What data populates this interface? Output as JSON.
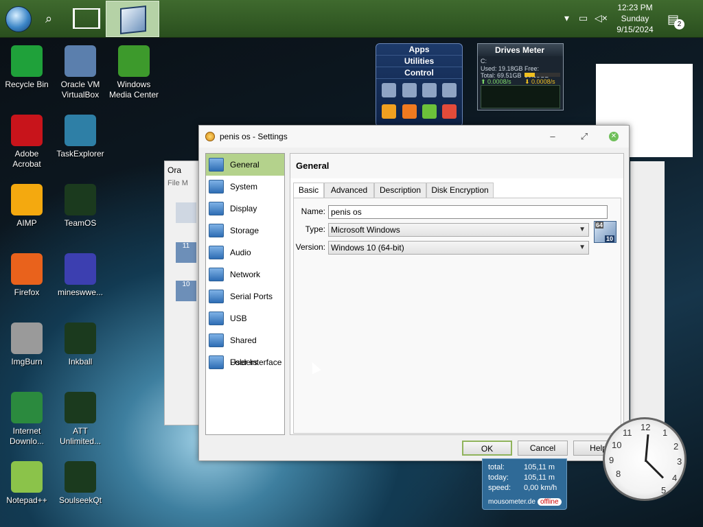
{
  "taskbar": {
    "start_icon": "windows-orb",
    "search_icon": "search-icon",
    "taskview_icon": "task-view-icon",
    "pinned_app": "virtualbox-icon",
    "tray_icons": [
      "chevron-up-icon",
      "network-icon",
      "volume-muted-icon"
    ],
    "clock": {
      "time": "12:23 PM",
      "day": "Sunday",
      "date": "9/15/2024"
    },
    "notifications_count": "2"
  },
  "desktop_icons": [
    {
      "label": "Recycle Bin",
      "icon": "recycle-bin-icon",
      "color": "#1fa13a"
    },
    {
      "label": "Oracle VM VirtualBox",
      "icon": "virtualbox-icon",
      "color": "#5b7fad"
    },
    {
      "label": "Windows Media Center",
      "icon": "media-center-icon",
      "color": "#3d9a2c"
    },
    {
      "label": "Adobe Acrobat",
      "icon": "acrobat-icon",
      "color": "#c8141b"
    },
    {
      "label": "TaskExplorer",
      "icon": "task-explorer-icon",
      "color": "#2e7fa6"
    },
    {
      "label": "AIMP",
      "icon": "aimp-icon",
      "color": "#f4a90f"
    },
    {
      "label": "TeamOS",
      "icon": "teamos-icon",
      "color": "#1b3a1e"
    },
    {
      "label": "Firefox",
      "icon": "firefox-icon",
      "color": "#e9621c"
    },
    {
      "label": "mineswwe...",
      "icon": "minesweeper-icon",
      "color": "#3c3fb0"
    },
    {
      "label": "ImgBurn",
      "icon": "imgburn-icon",
      "color": "#9a9a9a"
    },
    {
      "label": "Inkball",
      "icon": "inkball-icon",
      "color": "#1b3a1e"
    },
    {
      "label": "Internet Downlo...",
      "icon": "idm-icon",
      "color": "#2b8a3e"
    },
    {
      "label": "ATT Unlimited...",
      "icon": "att-icon",
      "color": "#1b3a1e"
    },
    {
      "label": "Notepad++",
      "icon": "notepadpp-icon",
      "color": "#8bc34a"
    },
    {
      "label": "SoulseekQt",
      "icon": "soulseek-icon",
      "color": "#1b3a1e"
    }
  ],
  "widgets": {
    "apps_menu": [
      "Apps",
      "Utilities",
      "Control"
    ],
    "drives_meter": {
      "title": "Drives Meter",
      "drive": "C:",
      "used": "Used: 19.18GB",
      "free": "Free: 50.33GB",
      "total": "Total: 69.51GB",
      "read": "0.0008/s",
      "write": "0.0008/s"
    },
    "mousometer": {
      "rows": [
        {
          "label": "total:",
          "value": "105,11 m"
        },
        {
          "label": "today:",
          "value": "105,11 m"
        },
        {
          "label": "speed:",
          "value": "0,00 km/h"
        }
      ],
      "brand": "mousometer.de",
      "status": "offline"
    },
    "clock_numbers": [
      "12",
      "1",
      "2",
      "3",
      "4",
      "5",
      "8",
      "9",
      "10",
      "11"
    ]
  },
  "background_window": {
    "title": "Ora",
    "menu": "File",
    "menu2": "M",
    "vm_badges": [
      "11",
      "10"
    ]
  },
  "settings_dialog": {
    "title": "penis os - Settings",
    "sidebar": [
      {
        "label": "General",
        "icon": "general-icon"
      },
      {
        "label": "System",
        "icon": "system-icon"
      },
      {
        "label": "Display",
        "icon": "display-icon"
      },
      {
        "label": "Storage",
        "icon": "storage-icon"
      },
      {
        "label": "Audio",
        "icon": "audio-icon"
      },
      {
        "label": "Network",
        "icon": "network-icon"
      },
      {
        "label": "Serial Ports",
        "icon": "serial-ports-icon"
      },
      {
        "label": "USB",
        "icon": "usb-icon"
      },
      {
        "label": "Shared Folders",
        "icon": "shared-folders-icon"
      },
      {
        "label": "User Interface",
        "icon": "user-interface-icon"
      }
    ],
    "section_title": "General",
    "tabs": [
      "Basic",
      "Advanced",
      "Description",
      "Disk Encryption"
    ],
    "fields": {
      "name_label": "Name:",
      "name_value": "penis os",
      "type_label": "Type:",
      "type_value": "Microsoft Windows",
      "version_label": "Version:",
      "version_value": "Windows 10 (64-bit)",
      "os_badge_top": "64",
      "os_badge_num": "10"
    },
    "buttons": {
      "ok": "OK",
      "cancel": "Cancel",
      "help": "Help"
    },
    "accent": "#b4d28c"
  }
}
